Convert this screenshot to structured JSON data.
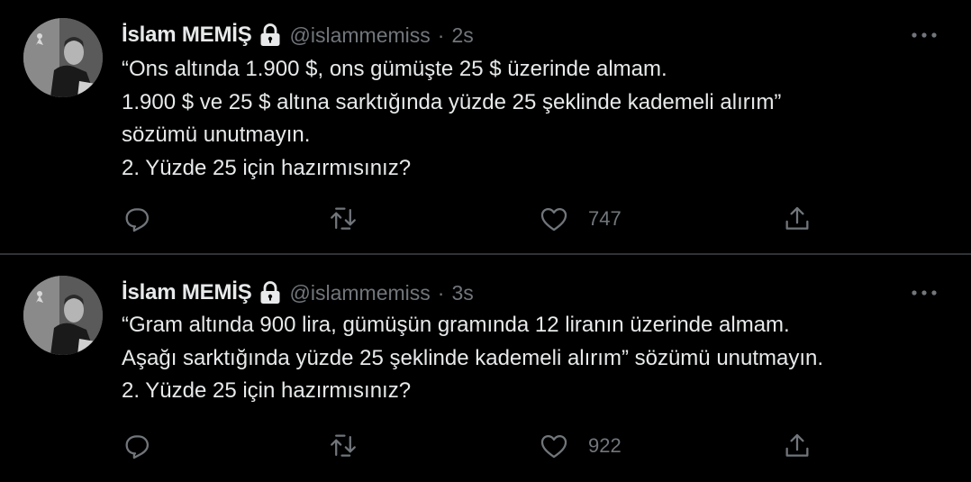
{
  "tweets": [
    {
      "display_name": "İslam MEMİŞ",
      "handle": "@islammemiss",
      "separator": "·",
      "time": "2s",
      "text": "“Ons altında 1.900 $, ons gümüşte 25 $ üzerinde almam.\n1.900 $ ve 25 $ altına sarktığında yüzde 25 şeklinde kademeli alırım”\nsözümü unutmayın.\n2. Yüzde 25 için hazırmısınız?",
      "like_count": "747",
      "icons": [
        "lock-icon",
        "more-icon",
        "reply-icon",
        "retweet-icon",
        "like-icon",
        "share-icon"
      ]
    },
    {
      "display_name": "İslam MEMİŞ",
      "handle": "@islammemiss",
      "separator": "·",
      "time": "3s",
      "text": "“Gram altında 900 lira, gümüşün gramında 12 liranın üzerinde almam.\nAşağı sarktığında yüzde 25 şeklinde kademeli alırım” sözümü unutmayın.\n2. Yüzde 25 için hazırmısınız?",
      "like_count": "922",
      "icons": [
        "lock-icon",
        "more-icon",
        "reply-icon",
        "retweet-icon",
        "like-icon",
        "share-icon"
      ]
    }
  ],
  "colors": {
    "background": "#000000",
    "primary_text": "#e7e9ea",
    "secondary_text": "#71767b",
    "divider": "#2f3336"
  }
}
